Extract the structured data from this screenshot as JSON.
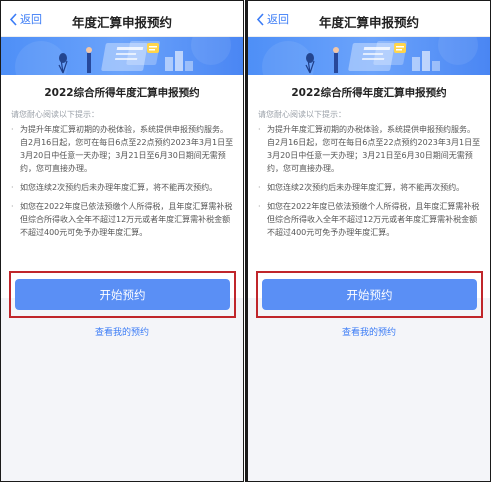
{
  "header": {
    "back_label": "返回",
    "title": "年度汇算申报预约"
  },
  "card": {
    "title": "2022综合所得年度汇算申报预约",
    "notice": "请您耐心阅读以下提示：",
    "items": [
      "为提升年度汇算初期的办税体验，系统提供申报预约服务。自2月16日起，您可在每日6点至22点预约2023年3月1日至3月20日中任意一天办理；3月21日至6月30日期间无需预约，您可直接办理。",
      "如您连续2次预约后未办理年度汇算，将不能再次预约。",
      "如您在2022年度已依法预缴个人所得税，且年度汇算需补税但综合所得收入全年不超过12万元或者年度汇算需补税金额不超过400元可免予办理年度汇算。"
    ]
  },
  "actions": {
    "primary_label": "开始预约",
    "link_label": "查看我的预约"
  },
  "colors": {
    "accent": "#3b7cf6",
    "button": "#5a8ff5",
    "highlight_border": "#c0262b"
  }
}
